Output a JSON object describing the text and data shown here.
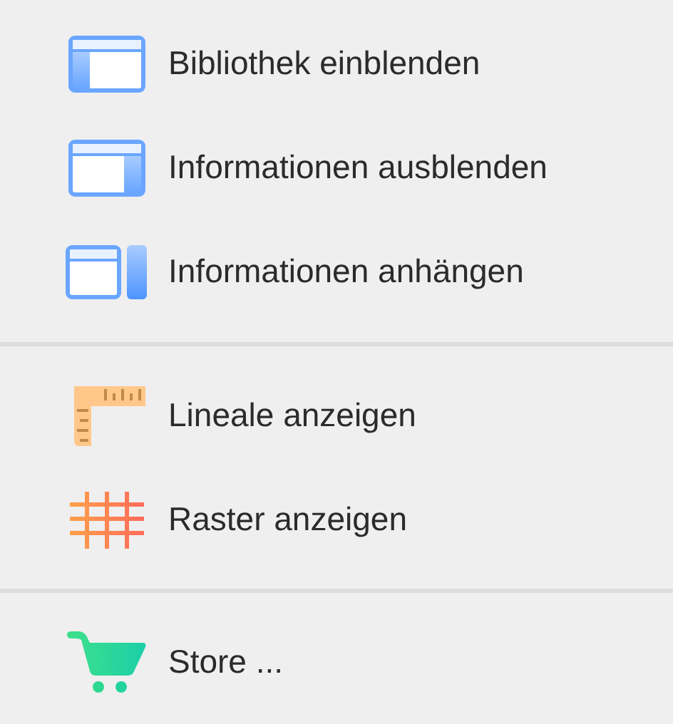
{
  "menu_groups": [
    {
      "items": [
        {
          "label": "Bibliothek einblenden",
          "kind": "sidebar-left"
        },
        {
          "label": "Informationen ausblenden",
          "kind": "sidebar-right"
        },
        {
          "label": "Informationen anhängen",
          "kind": "panel-detached"
        }
      ]
    },
    {
      "items": [
        {
          "label": "Lineale anzeigen",
          "kind": "ruler"
        },
        {
          "label": "Raster anzeigen",
          "kind": "grid"
        }
      ]
    },
    {
      "items": [
        {
          "label": "Store ...",
          "kind": "cart"
        }
      ]
    }
  ]
}
